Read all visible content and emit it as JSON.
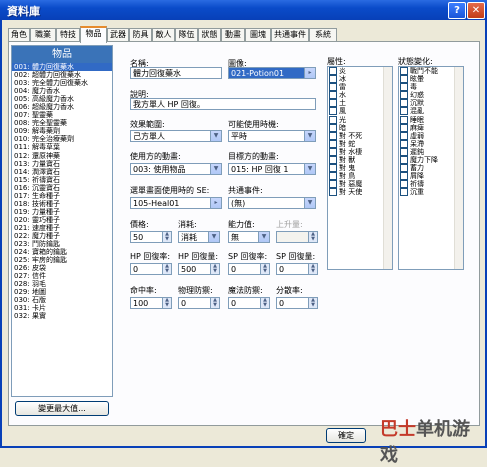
{
  "window": {
    "title": "資料庫"
  },
  "tabs": [
    "角色",
    "職業",
    "特技",
    "物品",
    "武器",
    "防具",
    "敵人",
    "隊伍",
    "狀態",
    "動畫",
    "圖塊",
    "共通事件",
    "系統"
  ],
  "list": {
    "header": "物品",
    "items": [
      "001: 體力回復藥水",
      "002: 超體力回復藥水",
      "003: 完全體力回復藥水",
      "004: 魔力香水",
      "005: 高級魔力香水",
      "006: 超級魔力香水",
      "007: 聖靈藥",
      "008: 完全聖靈藥",
      "009: 解毒藥劑",
      "010: 完全治療藥劑",
      "011: 解毒草葉",
      "012: 還原神藥",
      "013: 力量寶石",
      "014: 潤澤寶石",
      "015: 祈禱寶石",
      "016: 沉靈寶石",
      "017: 生命種子",
      "018: 技術種子",
      "019: 力量種子",
      "020: 靈巧種子",
      "021: 速度種子",
      "022: 魔力種子",
      "023: 鬥防鑰匙",
      "024: 寶箱的鑰匙",
      "025: 牢房的鑰匙",
      "026: 皮袋",
      "027: 信件",
      "028: 羽毛",
      "029: 地圖",
      "030: 石版",
      "031: 卡片",
      "032: 果實"
    ],
    "selected_index": 0,
    "change_max_button": "變更最大值..."
  },
  "form": {
    "name_label": "名稱:",
    "name_value": "體力回復藥水",
    "icon_label": "圖像:",
    "icon_value": "021-Potion01",
    "desc_label": "說明:",
    "desc_value": "我方單人 HP 回復。",
    "scope_label": "效果範圍:",
    "scope_value": "己方單人",
    "occasion_label": "可能使用時機:",
    "occasion_value": "平時",
    "user_anim_label": "使用方的動畫:",
    "user_anim_value": "003: 使用物品",
    "target_anim_label": "目標方的動畫:",
    "target_anim_value": "015: HP 回復 1",
    "menu_se_label": "選單畫面使用時的 SE:",
    "menu_se_value": "105-Heal01",
    "common_event_label": "共通事件:",
    "common_event_value": "(無)",
    "price_label": "價格:",
    "price_value": "50",
    "consume_label": "消耗:",
    "consume_value": "消耗",
    "param_label": "能力值:",
    "param_value": "無",
    "param_inc_label": "上升量:",
    "param_inc_value": "",
    "hp_rate_label": "HP 回復率:",
    "hp_rate_value": "0",
    "hp_amt_label": "HP 回復量:",
    "hp_amt_value": "500",
    "sp_rate_label": "SP 回復率:",
    "sp_rate_value": "0",
    "sp_amt_label": "SP 回復量:",
    "sp_amt_value": "0",
    "hit_label": "命中率:",
    "hit_value": "100",
    "pdef_label": "物理防禦:",
    "pdef_value": "0",
    "mdef_label": "魔法防禦:",
    "mdef_value": "0",
    "variance_label": "分散率:",
    "variance_value": "0"
  },
  "elements": {
    "label": "屬性:",
    "items": [
      "炎",
      "冰",
      "雷",
      "水",
      "土",
      "風",
      "光",
      "暗",
      "對 不死",
      "對 蛇",
      "對 水棲",
      "對 獸",
      "對 鬼",
      "對 鳥",
      "對 惡魔",
      "對 天使"
    ]
  },
  "states": {
    "label": "狀態變化:",
    "items": [
      "戰鬥不能",
      "眩暈",
      "毒",
      "幻惑",
      "沉默",
      "混亂",
      "睡眠",
      "麻痺",
      "虛弱",
      "呆滯",
      "遲鈍",
      "魔力下降",
      "蓄力",
      "屑降",
      "祈禱",
      "沉重"
    ]
  },
  "footer": {
    "ok_button": "確定"
  },
  "watermark": {
    "main": "巴士",
    "sub": "单机游戏"
  }
}
